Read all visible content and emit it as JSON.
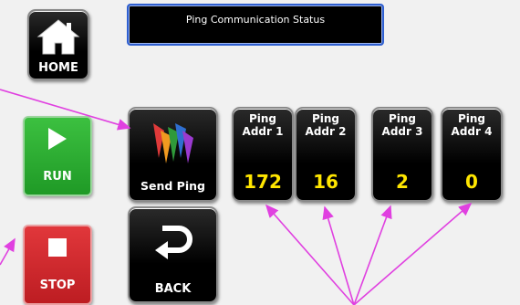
{
  "header": {
    "title": "Ping Communication Status"
  },
  "home_button": {
    "label": "HOME"
  },
  "run_button": {
    "label": "RUN"
  },
  "stop_button": {
    "label": "STOP"
  },
  "send_ping_button": {
    "label": "Send Ping"
  },
  "back_button": {
    "label": "BACK"
  },
  "ping_addresses": [
    {
      "label_top": "Ping",
      "label_bottom": "Addr 1",
      "value": "172"
    },
    {
      "label_top": "Ping",
      "label_bottom": "Addr 2",
      "value": "16"
    },
    {
      "label_top": "Ping",
      "label_bottom": "Addr 3",
      "value": "2"
    },
    {
      "label_top": "Ping",
      "label_bottom": "Addr 4",
      "value": "0"
    }
  ],
  "colors": {
    "title_border": "#2f5fd0",
    "run": "#2aaa2f",
    "stop": "#cc2327",
    "value_text": "#ffe600",
    "callout": "#e040e0"
  }
}
